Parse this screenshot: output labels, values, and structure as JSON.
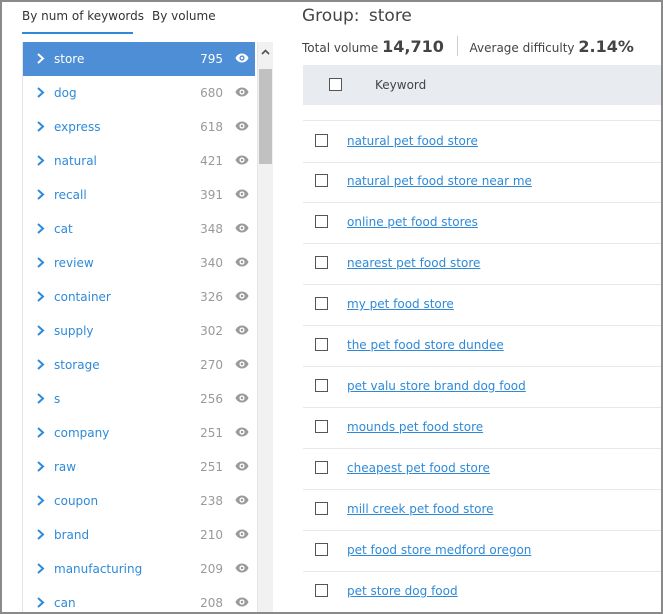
{
  "tabs": [
    {
      "label": "By num of keywords",
      "active": true
    },
    {
      "label": "By volume",
      "active": false
    }
  ],
  "sidebar": {
    "items": [
      {
        "label": "store",
        "count": "795",
        "selected": true
      },
      {
        "label": "dog",
        "count": "680"
      },
      {
        "label": "express",
        "count": "618"
      },
      {
        "label": "natural",
        "count": "421"
      },
      {
        "label": "recall",
        "count": "391"
      },
      {
        "label": "cat",
        "count": "348"
      },
      {
        "label": "review",
        "count": "340"
      },
      {
        "label": "container",
        "count": "326"
      },
      {
        "label": "supply",
        "count": "302"
      },
      {
        "label": "storage",
        "count": "270"
      },
      {
        "label": "s",
        "count": "256"
      },
      {
        "label": "company",
        "count": "251"
      },
      {
        "label": "raw",
        "count": "251"
      },
      {
        "label": "coupon",
        "count": "238"
      },
      {
        "label": "brand",
        "count": "210"
      },
      {
        "label": "manufacturing",
        "count": "209"
      },
      {
        "label": "can",
        "count": "208"
      }
    ]
  },
  "group": {
    "label": "Group:",
    "name": "store",
    "total_volume_label": "Total volume",
    "total_volume": "14,710",
    "avg_difficulty_label": "Average difficulty",
    "avg_difficulty": "2.14%"
  },
  "table": {
    "header": "Keyword",
    "rows": [
      "natural pet food store",
      "natural pet food store near me",
      "online pet food stores",
      "nearest pet food store",
      "my pet food store",
      "the pet food store dundee",
      "pet valu store brand dog food",
      "mounds pet food store",
      "cheapest pet food store",
      "mill creek pet food store",
      "pet food store medford oregon",
      "pet store dog food"
    ]
  },
  "colors": {
    "accent": "#2e8ad8",
    "selected_bg": "#4d8ed6",
    "header_bg": "#e8ebf0"
  },
  "icons": {
    "list_expand": "chevron-right-icon",
    "list_view": "eye-icon",
    "scroll_up": "chevron-up-icon"
  }
}
